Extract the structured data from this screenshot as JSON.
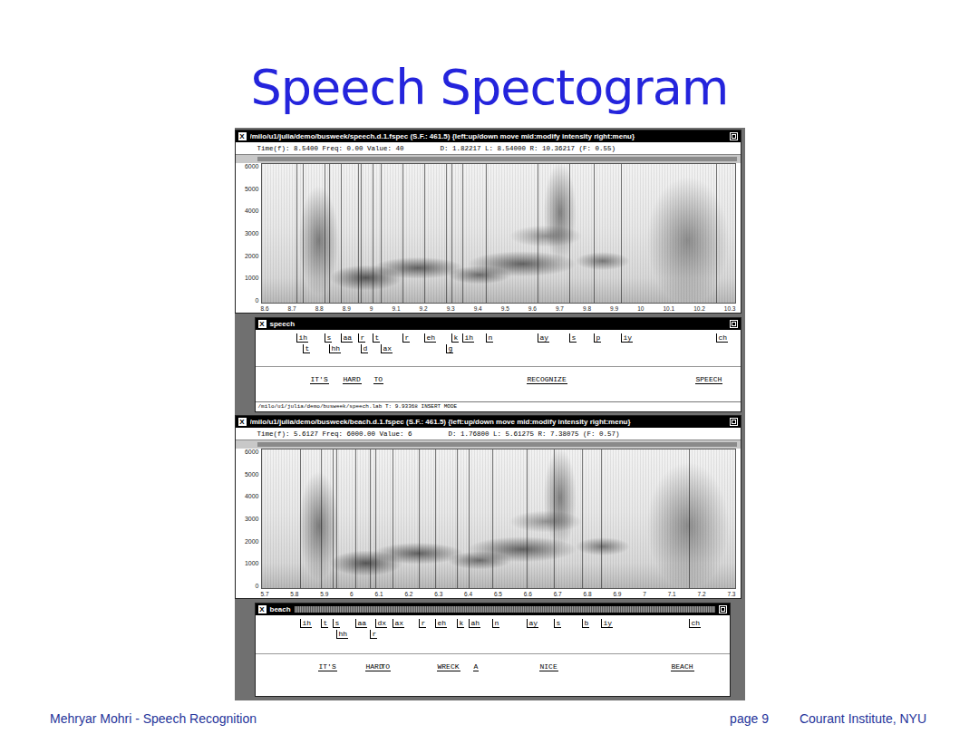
{
  "slide": {
    "title": "Speech Spectogram",
    "footer": {
      "author": "Mehryar Mohri - Speech Recognition",
      "page": "page 9",
      "institute": "Courant Institute, NYU"
    }
  },
  "windows": [
    {
      "spectrogram": {
        "icon": "X",
        "title": "/milo/u1/julia/demo/busweek/speech.d.1.fspec (S.F.: 461.5) {left:up/down move mid:modify intensity right:menu}",
        "cursor": "Time(f): 8.5400 Freq: 0.00 Value: 40",
        "range": "D: 1.82217 L: 8.54000 R: 10.36217 (F: 0.55)",
        "y_ticks": [
          "6000",
          "5000",
          "4000",
          "3000",
          "2000",
          "1000",
          "0"
        ],
        "x_ticks": [
          "8.6",
          "8.7",
          "8.8",
          "8.9",
          "9",
          "9.1",
          "9.2",
          "9.3",
          "9.4",
          "9.5",
          "9.6",
          "9.7",
          "9.8",
          "9.9",
          "10",
          "10.1",
          "10.2",
          "10.3"
        ]
      },
      "labels": {
        "icon": "X",
        "title": "speech",
        "phones": [
          "ih",
          "t",
          "s",
          "hh",
          "aa",
          "r",
          "d",
          "t",
          "ax",
          "r",
          "eh",
          "k",
          "ih",
          "g",
          "n",
          "ay",
          "s",
          "p",
          "iy",
          "ch"
        ],
        "words": [
          "IT'S",
          "HARD",
          "TO",
          "RECOGNIZE",
          "SPEECH"
        ],
        "status": "/milo/u1/julia/demo/busweek/speech.lab T: 9.93368 INSERT MODE"
      }
    },
    {
      "spectrogram": {
        "icon": "X",
        "title": "/milo/u1/julia/demo/busweek/beach.d.1.fspec (S.F.: 461.5) {left:up/down move mid:modify intensity right:menu}",
        "cursor": "Time(f): 5.6127 Freq: 6000.00 Value: 6",
        "range": "D: 1.76800 L: 5.61275 R: 7.38075 (F: 0.57)",
        "y_ticks": [
          "6000",
          "5000",
          "4000",
          "3000",
          "2000",
          "1000",
          "0"
        ],
        "x_ticks": [
          "5.7",
          "5.8",
          "5.9",
          "6",
          "6.1",
          "6.2",
          "6.3",
          "6.4",
          "6.5",
          "6.6",
          "6.7",
          "6.8",
          "6.9",
          "7",
          "7.1",
          "7.2",
          "7.3"
        ]
      },
      "labels": {
        "icon": "X",
        "title": "beach",
        "phones": [
          "ih",
          "t",
          "s",
          "hh",
          "aa",
          "dx",
          "r",
          "ax",
          "r",
          "eh",
          "k",
          "ah",
          "n",
          "ay",
          "s",
          "b",
          "iy",
          "ch"
        ],
        "words": [
          "IT'S",
          "HARD",
          "TO",
          "WRECK",
          "A",
          "NICE",
          "BEACH"
        ]
      }
    }
  ]
}
